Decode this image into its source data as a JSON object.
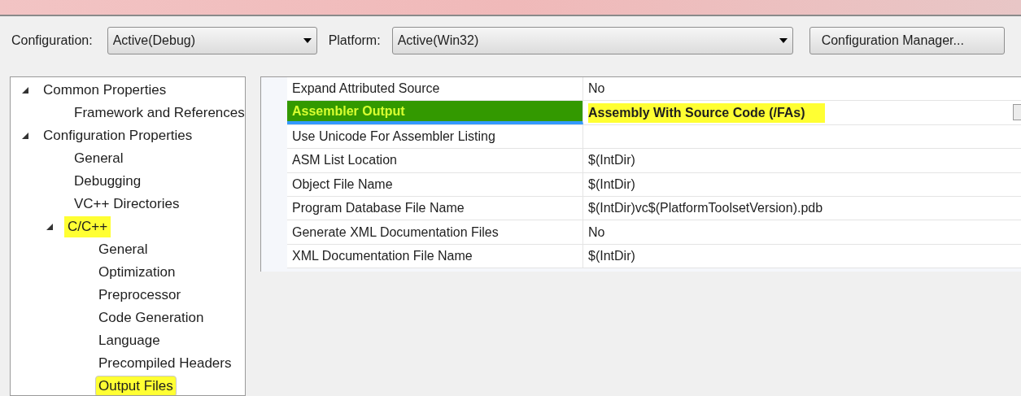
{
  "toolbar": {
    "configuration": {
      "label": "Configuration:",
      "value": "Active(Debug)"
    },
    "platform": {
      "label": "Platform:",
      "value": "Active(Win32)"
    },
    "manager_button": "Configuration Manager..."
  },
  "tree": [
    {
      "label": "Common Properties",
      "expanded": true,
      "selected": false,
      "highlighted": false,
      "children": [
        {
          "label": "Framework and References",
          "selected": false,
          "highlighted": false
        }
      ]
    },
    {
      "label": "Configuration Properties",
      "expanded": true,
      "selected": false,
      "highlighted": false,
      "children": [
        {
          "label": "General",
          "selected": false,
          "highlighted": false
        },
        {
          "label": "Debugging",
          "selected": false,
          "highlighted": false
        },
        {
          "label": "VC++ Directories",
          "selected": false,
          "highlighted": false
        },
        {
          "label": "C/C++",
          "expanded": true,
          "selected": false,
          "highlighted": true,
          "children": [
            {
              "label": "General",
              "selected": false,
              "highlighted": false
            },
            {
              "label": "Optimization",
              "selected": false,
              "highlighted": false
            },
            {
              "label": "Preprocessor",
              "selected": false,
              "highlighted": false
            },
            {
              "label": "Code Generation",
              "selected": false,
              "highlighted": false
            },
            {
              "label": "Language",
              "selected": false,
              "highlighted": false
            },
            {
              "label": "Precompiled Headers",
              "selected": false,
              "highlighted": false
            },
            {
              "label": "Output Files",
              "selected": true,
              "highlighted": true
            }
          ]
        }
      ]
    }
  ],
  "properties": [
    {
      "name": "Expand Attributed Source",
      "value": "No",
      "selected": false,
      "highlighted": false,
      "modified": false
    },
    {
      "name": "Assembler Output",
      "value": "Assembly With Source Code (/FAs)",
      "selected": true,
      "highlighted": true,
      "modified": true
    },
    {
      "name": "Use Unicode For Assembler Listing",
      "selected": false,
      "highlighted": false,
      "modified": false
    },
    {
      "name": "ASM List Location",
      "value": "$(IntDir)",
      "selected": false,
      "highlighted": false,
      "modified": false
    },
    {
      "name": "Object File Name",
      "value": "$(IntDir)",
      "selected": false,
      "highlighted": false,
      "modified": false
    },
    {
      "name": "Program Database File Name",
      "value": "$(IntDir)vc$(PlatformToolsetVersion).pdb",
      "selected": false,
      "highlighted": false,
      "modified": false
    },
    {
      "name": "Generate XML Documentation Files",
      "value": "No",
      "selected": false,
      "highlighted": false,
      "modified": false
    },
    {
      "name": "XML Documentation File Name",
      "value": "$(IntDir)",
      "selected": false,
      "highlighted": false,
      "modified": false
    }
  ]
}
